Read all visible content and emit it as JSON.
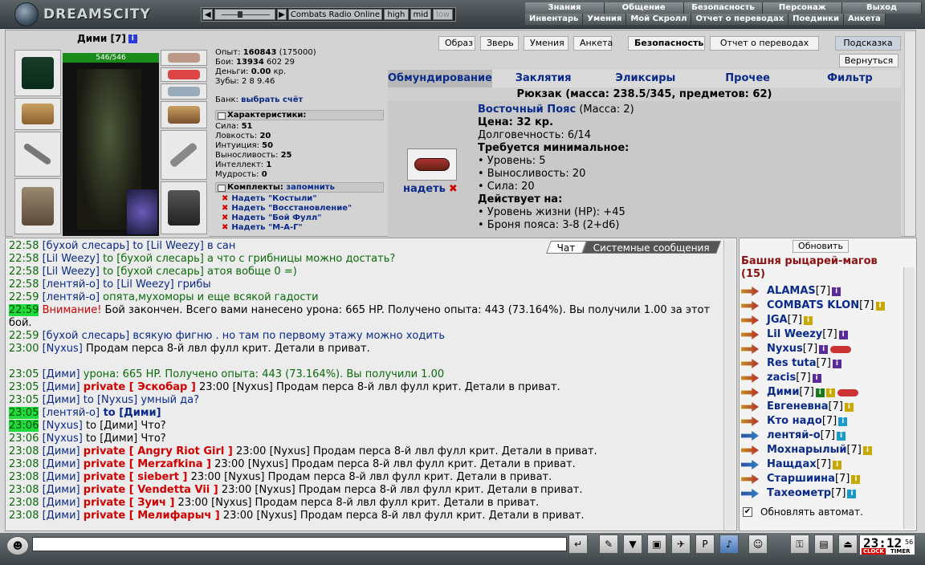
{
  "app": {
    "logo_text": "DREAMSCITY"
  },
  "radio": {
    "name": "Combats Radio Online",
    "high": "high",
    "mid": "mid",
    "low": "low"
  },
  "menu_top": [
    "Знания",
    "Общение",
    "Безопасность",
    "Персонаж",
    "Выход"
  ],
  "menu_sub": [
    "Инвентарь",
    "Умения",
    "Мой Скролл",
    "Отчет о переводах",
    "Поединки",
    "Анкета"
  ],
  "character": {
    "name": "Дими [7]",
    "hp": "546/546",
    "stats_lines": [
      {
        "label": "Опыт: ",
        "value": "160843",
        "extra": " (175000)"
      },
      {
        "label": "Бои: ",
        "value": "13934",
        "extra": "   602     29"
      },
      {
        "label": "Деньги: ",
        "value": "0.00",
        "extra": " кр."
      },
      {
        "label": "Зубы: ",
        "value": "",
        "extra": "2  8  9.46"
      }
    ],
    "bank_label": "Банк:",
    "bank_link": "выбрать счёт",
    "char_header": "Характеристики:",
    "attributes": [
      {
        "label": "Сила: ",
        "value": "51"
      },
      {
        "label": "Ловкость: ",
        "value": "20"
      },
      {
        "label": "Интуиция: ",
        "value": "50"
      },
      {
        "label": "Выносливость: ",
        "value": "25"
      },
      {
        "label": "Интеллект: ",
        "value": "1"
      },
      {
        "label": "Мудрость: ",
        "value": "0"
      }
    ],
    "sets_header": "Комплекты:",
    "sets_remember": "запомнить",
    "sets": [
      "Надеть \"Костыли\"",
      "Надеть \"Восстановление\"",
      "Надеть \"Бой Фулл\"",
      "Надеть \"М-А-Г\""
    ]
  },
  "nav_buttons": [
    "Образ",
    "Зверь",
    "Умения",
    "Анкета",
    "Безопасность",
    "Отчет о переводах"
  ],
  "hint_button": "Подсказка",
  "back_button": "Вернуться",
  "inventory": {
    "tabs": [
      "Обмундирование",
      "Заклятия",
      "Эликсиры",
      "Прочее",
      "Фильтр"
    ],
    "backpack": "Рюкзак (масса: 238.5/345, предметов: 62)",
    "item": {
      "name": "Восточный Пояс",
      "mass": " (Масса: 2)",
      "price": "Цена: 32 кр.",
      "durability": "Долговечность: 6/14",
      "req_title": "Требуется минимальное:",
      "reqs": [
        "• Уровень: 5",
        "• Выносливость: 20",
        "• Сила: 20"
      ],
      "acts_title": "Действует на:",
      "acts": [
        "• Уровень жизни (HP): +45",
        "• Броня пояса: 3-8 (2+d6)"
      ],
      "wear_label": "надеть"
    }
  },
  "chat": {
    "tab_chat": "Чат",
    "tab_system": "Системные сообщения",
    "lines": [
      {
        "t": "22:58",
        "n": "[бухой слесарь]",
        "c": "blu",
        "m": " to [Lil Weezy] в сан"
      },
      {
        "t": "22:58",
        "n": "[Lil Weezy]",
        "c": "grn",
        "m": " to [бухой слесарь] а что с грибницы можно достать?"
      },
      {
        "t": "22:58",
        "n": "[Lil Weezy]",
        "c": "grn",
        "m": " to [бухой слесарь] атоя вобще 0 =)"
      },
      {
        "t": "22:58",
        "n": "[лентяй-о]",
        "c": "blu",
        "m": " to [Lil Weezy] грибы"
      },
      {
        "t": "22:59",
        "n": "[лентяй-о]",
        "c": "grn",
        "m": " опята,мухоморы и еще всякой гадости"
      },
      {
        "t": "22:59",
        "hl": true,
        "alert": "Внимание!",
        "m": " Бой закончен. Всего вами нанесено урона: 665 HP. Получено опыта: 443 (73.164%). Вы получили  1.00 за этот бой.",
        "wrap": true
      },
      {
        "t": "22:59",
        "n": "[бухой слесарь]",
        "c": "blu",
        "m": " всякую фигню . но там по первому этажу можно ходить"
      },
      {
        "t": "23:00",
        "n": "[Nyxus]",
        "c": "",
        "m": " Продам перса 8-й лвл фулл крит. Детали в приват."
      },
      {
        "t": "",
        "n": "",
        "c": "",
        "m": ""
      },
      {
        "t": "23:05",
        "n": "[Дими]",
        "c": "grn",
        "m": " урона: 665 HP. Получено опыта: 443 (73.164%). Вы получили 1.00"
      },
      {
        "t": "23:05",
        "n": "[Дими]",
        "c": "",
        "p": "private [ Эскобар ]",
        "m": " 23:00 [Nyxus] Продам перса 8-й лвл фулл крит. Детали в приват."
      },
      {
        "t": "23:05",
        "n": "[Дими]",
        "c": "blu",
        "m": " to [Nyxus] умный да?"
      },
      {
        "t": "23:05",
        "hl": true,
        "n": "[лентяй-о]",
        "c": "blu",
        "m": " to [Дими]"
      },
      {
        "t": "23:06",
        "hl": true,
        "n": "[Nyxus]",
        "c": "",
        "m": " to [Дими] Что?"
      },
      {
        "t": "23:06",
        "n": "[Nyxus]",
        "c": "",
        "m": " to [Дими] Что?"
      },
      {
        "t": "23:08",
        "n": "[Дими]",
        "c": "",
        "p": "private [ Angry Riot Girl ]",
        "m": " 23:00 [Nyxus] Продам перса 8-й лвл фулл крит. Детали в приват."
      },
      {
        "t": "23:08",
        "n": "[Дими]",
        "c": "",
        "p": "private [ Merzafkina ]",
        "m": " 23:00 [Nyxus] Продам перса 8-й лвл фулл крит. Детали в приват."
      },
      {
        "t": "23:08",
        "n": "[Дими]",
        "c": "",
        "p": "private [ siebert ]",
        "m": " 23:00 [Nyxus] Продам перса 8-й лвл фулл крит. Детали в приват."
      },
      {
        "t": "23:08",
        "n": "[Дими]",
        "c": "",
        "p": "private [ Vendetta Vii ]",
        "m": " 23:00 [Nyxus] Продам перса 8-й лвл фулл крит. Детали в приват."
      },
      {
        "t": "23:08",
        "n": "[Дими]",
        "c": "",
        "p": "private [ Зуич ]",
        "m": " 23:00 [Nyxus] Продам перса 8-й лвл фулл крит. Детали в приват."
      },
      {
        "t": "23:08",
        "n": "[Дими]",
        "c": "",
        "p": "private [ Мелифарыч ]",
        "m": " 23:00 [Nyxus] Продам перса 8-й лвл фулл крит. Детали в приват."
      }
    ]
  },
  "online": {
    "refresh_button": "Обновить",
    "room": "Башня рыцарей-магов (15)",
    "users": [
      {
        "name": "ALAMAS",
        "lvl": "[7]",
        "badge": "#5a2a9a",
        "badge2": "",
        "arrow": "gold"
      },
      {
        "name": "COMBATS KLON",
        "lvl": "[7]",
        "badge": "#c9a900",
        "badge2": "",
        "arrow": "gold"
      },
      {
        "name": "JGA",
        "lvl": "[7]",
        "badge": "#c9a900",
        "badge2": "",
        "arrow": "gold"
      },
      {
        "name": "Lil Weezy",
        "lvl": "[7]",
        "badge": "#5a2a9a",
        "badge2": "",
        "arrow": "gold"
      },
      {
        "name": "Nyxus",
        "lvl": "[7]",
        "badge": "#5a2a9a",
        "badge2": "",
        "arrow": "gold",
        "pet": true
      },
      {
        "name": "Res tuta",
        "lvl": "[7]",
        "badge": "#5a2a9a",
        "badge2": "",
        "arrow": "gold"
      },
      {
        "name": "zacis",
        "lvl": "[7]",
        "badge": "#5a2a9a",
        "badge2": "",
        "arrow": "gold"
      },
      {
        "name": "Дими",
        "lvl": "[7]",
        "badge": "#1a7a1a",
        "badge2": "#c9a900",
        "arrow": "gold",
        "pet": true
      },
      {
        "name": "Евгеневна",
        "lvl": "[7]",
        "badge": "#c9a900",
        "badge2": "",
        "arrow": "gold"
      },
      {
        "name": "Кто надо",
        "lvl": "[7]",
        "badge": "#1a9ac9",
        "badge2": "",
        "arrow": "gold"
      },
      {
        "name": "лентяй-о",
        "lvl": "[7]",
        "badge": "#1a9ac9",
        "badge2": "",
        "arrow": "blue"
      },
      {
        "name": "Мохнарылый",
        "lvl": "[7]",
        "badge": "#c9a900",
        "badge2": "",
        "arrow": "gold"
      },
      {
        "name": "Нащдах",
        "lvl": "[7]",
        "badge": "#c9a900",
        "badge2": "",
        "arrow": "blue"
      },
      {
        "name": "Старшиина",
        "lvl": "[7]",
        "badge": "#c9a900",
        "badge2": "",
        "arrow": "gold"
      },
      {
        "name": "Тахеометр",
        "lvl": "[7]",
        "badge": "#1a9ac9",
        "badge2": "",
        "arrow": "blue"
      }
    ],
    "auto_update": "Обновлять автомат."
  },
  "clock": {
    "time": "23:12",
    "seconds": "56",
    "label1": "CLOCK",
    "label2": "TIMER"
  }
}
